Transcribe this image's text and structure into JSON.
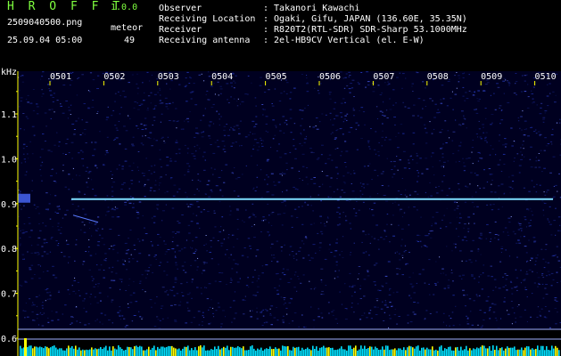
{
  "header": {
    "app_title": "H R O F F T",
    "version": "1.0.0",
    "filename": "2509040500.png",
    "meteor_label": "meteor",
    "datetime": "25.09.04 05:00",
    "meteor_count": "49"
  },
  "info": [
    {
      "key": "Observer",
      "value": ": Takanori Kawachi"
    },
    {
      "key": "Receiving Location",
      "value": ": Ogaki, Gifu, JAPAN (136.60E, 35.35N)"
    },
    {
      "key": "Receiver",
      "value": ": R820T2(RTL-SDR) SDR-Sharp 53.1000MHz"
    },
    {
      "key": "Receiving antenna",
      "value": ": 2el-HB9CV Vertical (el. E-W)"
    }
  ],
  "chart_data": {
    "type": "heatmap",
    "ylabel": "kHz",
    "x_ticks": [
      "0501",
      "0502",
      "0503",
      "0504",
      "0505",
      "0506",
      "0507",
      "0508",
      "0509",
      "0510"
    ],
    "y_ticks": [
      "1.1",
      "1.0",
      "0.9",
      "0.8",
      "0.7",
      "0.6"
    ],
    "ylim": [
      0.6,
      1.15
    ],
    "carrier_khz": 0.91,
    "colors": {
      "axis": "#ffff00",
      "carrier": "#7fdfff",
      "background": "#000020",
      "noise": "#1e2b8a",
      "bottom_bars": "#00e0ff",
      "accent_bars": "#ffff00"
    }
  }
}
